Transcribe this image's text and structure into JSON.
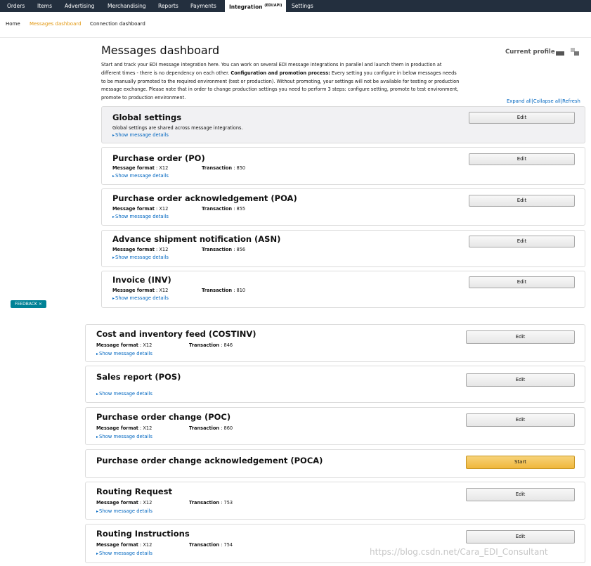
{
  "topnav": {
    "items": [
      "Orders",
      "Items",
      "Advertising",
      "Merchandising",
      "Reports",
      "Payments",
      "Integration",
      "Settings"
    ],
    "integration_sup": "(EDI/API)"
  },
  "breadcrumb": {
    "items": [
      "Home",
      "Messages dashboard",
      "Connection dashboard"
    ]
  },
  "header": {
    "title": "Messages dashboard",
    "profile_label": "Current profile",
    "intro_1": "Start and track your EDI message integration here. You can work on several EDI message integrations in parallel and launch them in production at different times - there is no dependency on each other. ",
    "intro_bold": "Configuration and promotion process:",
    "intro_2": " Every setting you configure in below messages needs to be manually promoted to the required environment (test or production). Without promoting, your settings will not be available for testing or production message exchange. Please note that in order to change production settings you need to perform 3 steps: configure setting, promote to test environment, promote to production environment.",
    "expand_all": "Expand all",
    "collapse_all": "Collapse all",
    "refresh": "Refresh"
  },
  "labels": {
    "message_format": "Message format",
    "transaction": "Transaction",
    "show_details": "Show message details",
    "edit": "Edit",
    "start": "Start"
  },
  "global_settings": {
    "title": "Global settings",
    "subtitle": "Global settings are shared across message integrations."
  },
  "messages": [
    {
      "title": "Purchase order (PO)",
      "format": "X12",
      "transaction": "850"
    },
    {
      "title": "Purchase order acknowledgement (POA)",
      "format": "X12",
      "transaction": "855"
    },
    {
      "title": "Advance shipment notification (ASN)",
      "format": "X12",
      "transaction": "856"
    },
    {
      "title": "Invoice (INV)",
      "format": "X12",
      "transaction": "810"
    },
    {
      "title": "Cost and inventory feed (COSTINV)",
      "format": "X12",
      "transaction": "846"
    },
    {
      "title": "Sales report (POS)"
    },
    {
      "title": "Purchase order change (POC)",
      "format": "X12",
      "transaction": "860"
    },
    {
      "title": "Purchase order change acknowledgement (POCA)"
    },
    {
      "title": "Routing Request",
      "format": "X12",
      "transaction": "753"
    },
    {
      "title": "Routing Instructions",
      "format": "X12",
      "transaction": "754"
    }
  ],
  "feedback": "FEEDBACK",
  "feedback_close": "×",
  "watermark": "https://blog.csdn.net/Cara_EDI_Consultant",
  "colors": {
    "nav_bg": "#232f3e",
    "link": "#0066c0",
    "active_crumb": "#e2960c",
    "start_button": "#f0b73c",
    "feedback": "#008296"
  }
}
